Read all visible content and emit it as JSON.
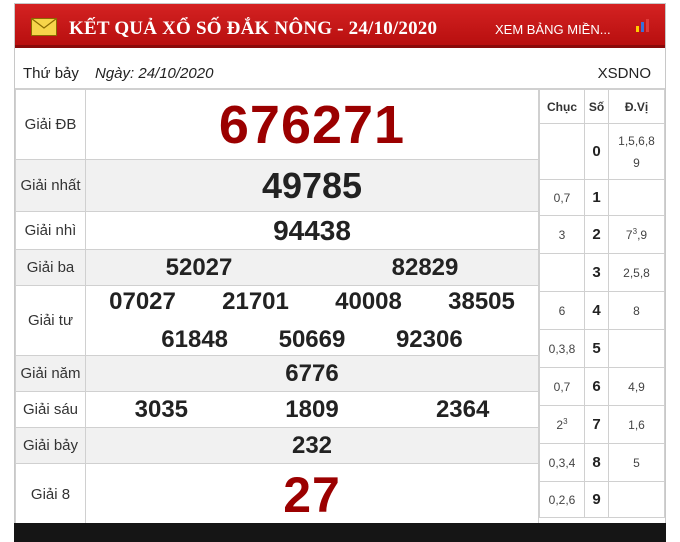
{
  "header": {
    "title": "KẾT QUẢ XỔ SỐ ĐẮK NÔNG - 24/10/2020",
    "see_more": "XEM BẢNG MIỀN...",
    "icons": [
      "envelope-icon",
      "chart-icon"
    ],
    "bg_color": "#c81a1a"
  },
  "info": {
    "day_of_week": "Thứ bảy",
    "date": "Ngày: 24/10/2020",
    "code": "XSDNO"
  },
  "prizes": {
    "db": {
      "label": "Giải ĐB",
      "numbers": [
        "676271"
      ]
    },
    "nhat": {
      "label": "Giải nhất",
      "numbers": [
        "49785"
      ]
    },
    "nhi": {
      "label": "Giải nhì",
      "numbers": [
        "94438"
      ]
    },
    "ba": {
      "label": "Giải ba",
      "numbers": [
        "52027",
        "82829"
      ]
    },
    "tu": {
      "label": "Giải tư",
      "numbers": [
        "07027",
        "21701",
        "40008",
        "38505",
        "61848",
        "50669",
        "92306"
      ]
    },
    "nam": {
      "label": "Giải năm",
      "numbers": [
        "6776"
      ]
    },
    "sau": {
      "label": "Giải sáu",
      "numbers": [
        "3035",
        "1809",
        "2364"
      ]
    },
    "bay": {
      "label": "Giải bảy",
      "numbers": [
        "232"
      ]
    },
    "tam": {
      "label": "Giải 8",
      "numbers": [
        "27"
      ]
    },
    "highlight_color": "#9b0000"
  },
  "loto": {
    "headers": {
      "chuc": "Chục",
      "so": "Số",
      "dvi": "Đ.Vị"
    },
    "rows": [
      {
        "chuc": "",
        "so": "0",
        "dvi": "1,5,6,8",
        "dvi2": "9"
      },
      {
        "chuc": "0,7",
        "so": "1",
        "dvi": ""
      },
      {
        "chuc": "3",
        "so": "2",
        "dvi": "7",
        "dvi_sup": "3",
        "dvi_tail": ",9"
      },
      {
        "chuc": "",
        "so": "3",
        "dvi": "2,5,8"
      },
      {
        "chuc": "6",
        "so": "4",
        "dvi": "8"
      },
      {
        "chuc": "0,3,8",
        "so": "5",
        "dvi": ""
      },
      {
        "chuc": "0,7",
        "so": "6",
        "dvi": "4,9"
      },
      {
        "chuc": "2",
        "chuc_sup": "3",
        "so": "7",
        "dvi": "1,6"
      },
      {
        "chuc": "0,3,4",
        "so": "8",
        "dvi": "5"
      },
      {
        "chuc": "0,2,6",
        "so": "9",
        "dvi": ""
      }
    ]
  }
}
